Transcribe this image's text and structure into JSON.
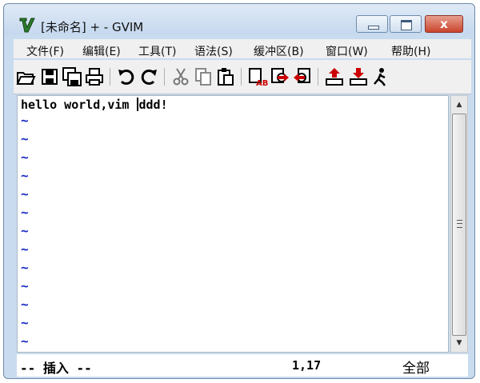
{
  "window": {
    "title": "[未命名] + - GVIM",
    "close_glyph": "x"
  },
  "menu": {
    "items": [
      "文件(F)",
      "编辑(E)",
      "工具(T)",
      "语法(S)",
      "缓冲区(B)",
      "窗口(W)",
      "帮助(H)"
    ]
  },
  "toolbar": {
    "icons": [
      "open-icon",
      "save-icon",
      "save-all-icon",
      "print-icon",
      "undo-icon",
      "redo-icon",
      "cut-icon",
      "copy-icon",
      "paste-icon",
      "replace-icon",
      "find-next-icon",
      "find-prev-icon",
      "load-session-icon",
      "save-session-icon",
      "run-script-icon"
    ]
  },
  "editor": {
    "line_before_cursor": "hello world,vim ",
    "line_after_cursor": "ddd!",
    "tilde": "~"
  },
  "status": {
    "mode": "-- 插入 --",
    "position": "1,17",
    "scroll": "全部"
  },
  "colors": {
    "tilde": "#1b2cc8",
    "title_bg": "#c9dbee",
    "close_button": "#c9442c"
  }
}
